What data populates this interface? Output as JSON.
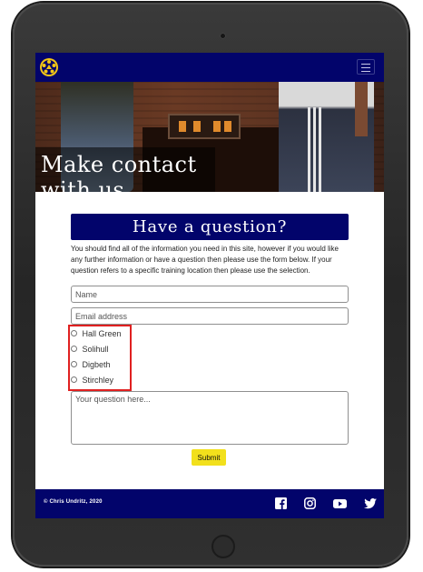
{
  "hero": {
    "title_line1": "Make contact",
    "title_line2": "with us..."
  },
  "form": {
    "heading": "Have a question?",
    "intro": "You should find all of the information you need in this site, however if you would like any further information or have a question then please use the form below. If your question refers to a specific training location then please use the selection.",
    "name_placeholder": "Name",
    "email_placeholder": "Email address",
    "locations": [
      "Hall Green",
      "Solihull",
      "Digbeth",
      "Stirchley"
    ],
    "question_placeholder": "Your question here...",
    "submit_label": "Submit"
  },
  "footer": {
    "copyright": "© Chris Undritz, 2020",
    "social": [
      "facebook-icon",
      "instagram-icon",
      "youtube-icon",
      "twitter-icon"
    ]
  },
  "colors": {
    "navy": "#02046b",
    "submit_yellow": "#f2e01c",
    "highlight_red": "#e02020"
  }
}
